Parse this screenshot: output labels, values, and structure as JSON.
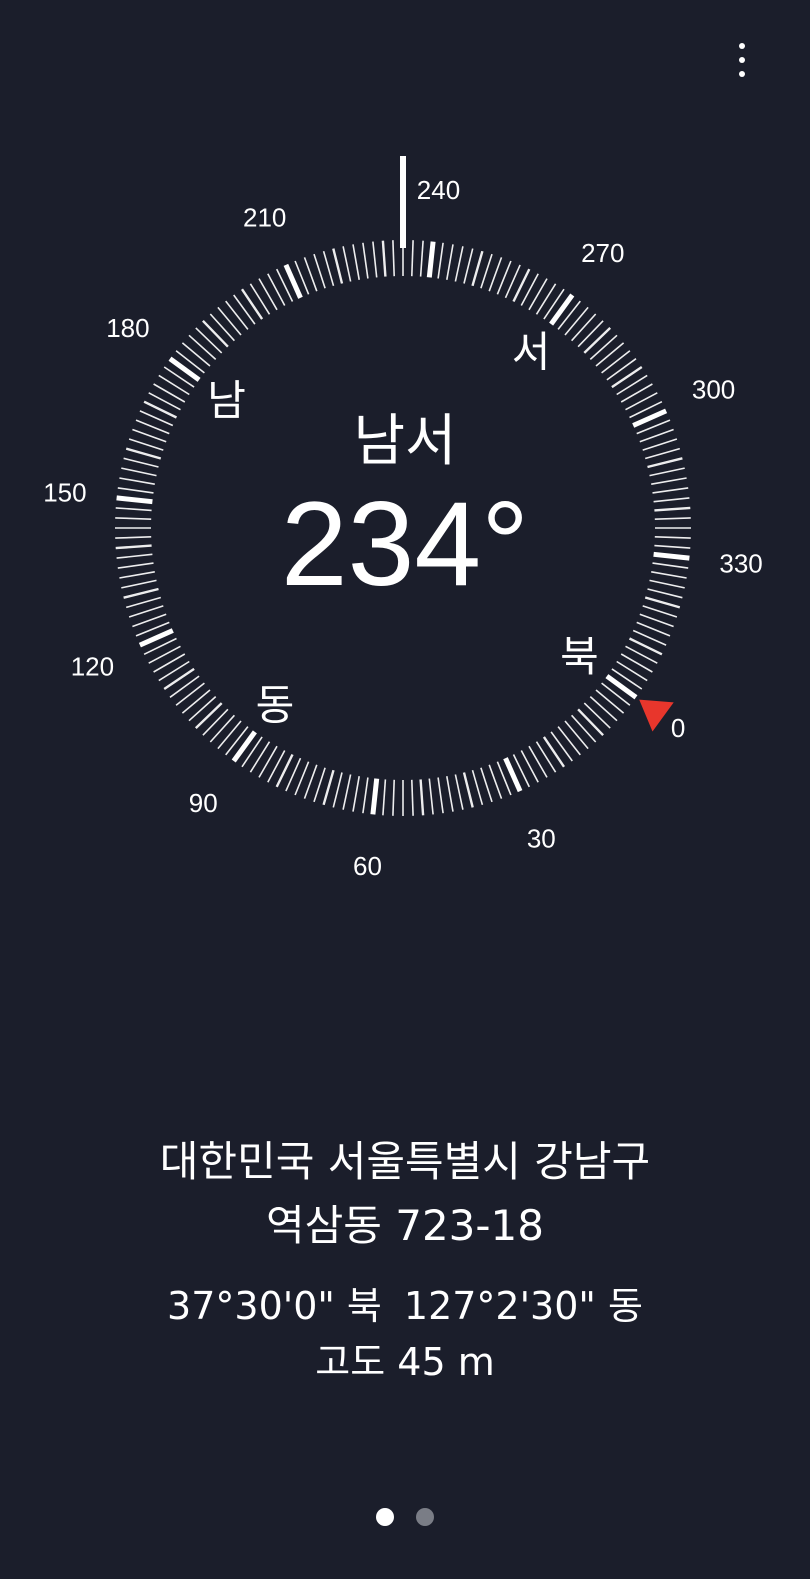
{
  "menu": {
    "icon": "more-vertical-icon"
  },
  "compass": {
    "heading_deg": 234,
    "direction_label": "남서",
    "heading_text": "234°",
    "cardinals": {
      "north": "북",
      "east": "동",
      "south": "남",
      "west": "서"
    },
    "degree_labels": [
      "0",
      "30",
      "60",
      "90",
      "120",
      "150",
      "180",
      "210",
      "240",
      "270",
      "300",
      "330"
    ],
    "north_marker_color": "#e8362c",
    "tick_color": "#ffffff"
  },
  "location": {
    "address_line1": "대한민국 서울특별시 강남구",
    "address_line2": "역삼동 723-18",
    "latitude": "37°30'0\" 북",
    "longitude": "127°2'30\" 동",
    "altitude": "고도 45 m"
  },
  "pager": {
    "count": 2,
    "active_index": 0
  }
}
